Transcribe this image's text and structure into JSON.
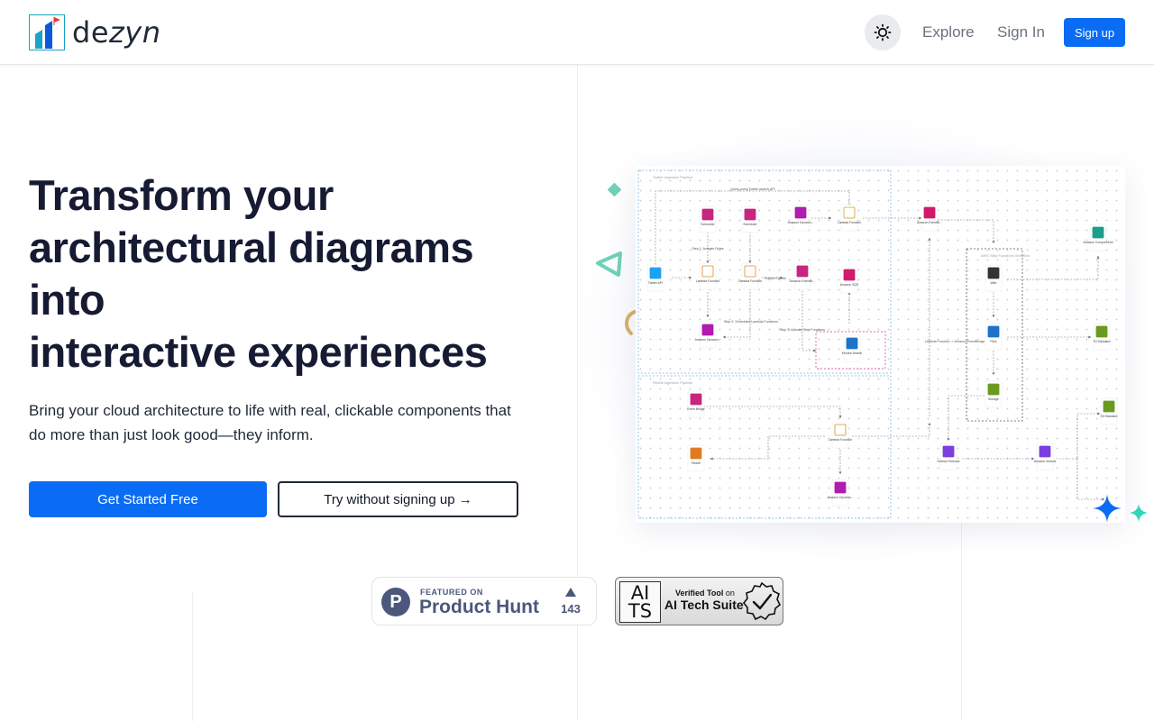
{
  "header": {
    "logo_text_upright": "de",
    "logo_text_italic": "zyn",
    "nav": [
      {
        "label": "Explore"
      },
      {
        "label": "Sign In"
      }
    ],
    "signup_label": "Sign up"
  },
  "hero": {
    "title_line1": "Transform your",
    "title_line2": "architectural diagrams",
    "title_line3": "into",
    "title_highlight": "interactive",
    "title_line4_rest": " experiences",
    "subtitle": "Bring your cloud architecture to life with real, clickable components that do more than just look good—they inform.",
    "primary_cta": "Get Started Free",
    "secondary_cta": "Try without signing up →"
  },
  "diagram": {
    "nodes": [
      {
        "label": "Scheduler"
      },
      {
        "label": "Scheduler"
      },
      {
        "label": "Amazon Dynamo..."
      },
      {
        "label": "Lambda Function"
      },
      {
        "label": "Amazon EventBr..."
      },
      {
        "label": "Amazon Comprehend"
      },
      {
        "label": "Twitter API"
      },
      {
        "label": "Lambda Function"
      },
      {
        "label": "Lambda Function"
      },
      {
        "label": "Amazon EventBr..."
      },
      {
        "label": "Amazon SQS"
      },
      {
        "label": "Amazon Dynamo..."
      },
      {
        "label": "Web"
      },
      {
        "label": "Files"
      },
      {
        "label": "Storage"
      },
      {
        "label": "S3 Standard"
      },
      {
        "label": "Event Bridge"
      },
      {
        "label": "Lambda Function"
      },
      {
        "label": "Reddit"
      },
      {
        "label": "Amazon Dynamo..."
      },
      {
        "label": "Kinesis Firehose"
      },
      {
        "label": "Amazon Kinesis"
      },
      {
        "label": "S3 Standard"
      },
      {
        "label": "Kendra Search"
      }
    ],
    "groups": [
      {
        "label": "Twitter Ingestion Pipeline"
      },
      {
        "label": "Reddit Ingestion Pipeline"
      },
      {
        "label": "AWS Step Functions Workflow"
      }
    ],
    "edges": [
      {
        "label": "Query using Twitter search API"
      },
      {
        "label": "Step 1: Activate Rules"
      },
      {
        "label": "Publish Tweets"
      },
      {
        "label": "Step 2: Scheduled Lambda Functions"
      },
      {
        "label": "Step 3: Activate Step Functions"
      },
      {
        "label": "Lambda Function -> Amazon EventBridge"
      }
    ]
  },
  "badges": {
    "producthunt": {
      "small": "FEATURED ON",
      "big": "Product Hunt",
      "count": "143",
      "logo_letter": "P"
    },
    "aits": {
      "box_top": "AI",
      "box_bottom": "TS",
      "line1_bold": "Verified Tool",
      "line1_rest": " on",
      "line2": "AI Tech Suite"
    }
  },
  "colors": {
    "primary": "#0a6cf5",
    "heading": "#161b33",
    "highlight": "#aefaf0",
    "muted_text": "#6b7280",
    "ph": "#4b587c"
  },
  "icons": {
    "theme_toggle": "sun-icon",
    "upvote": "triangle-up-icon",
    "verified": "check-seal-icon"
  }
}
